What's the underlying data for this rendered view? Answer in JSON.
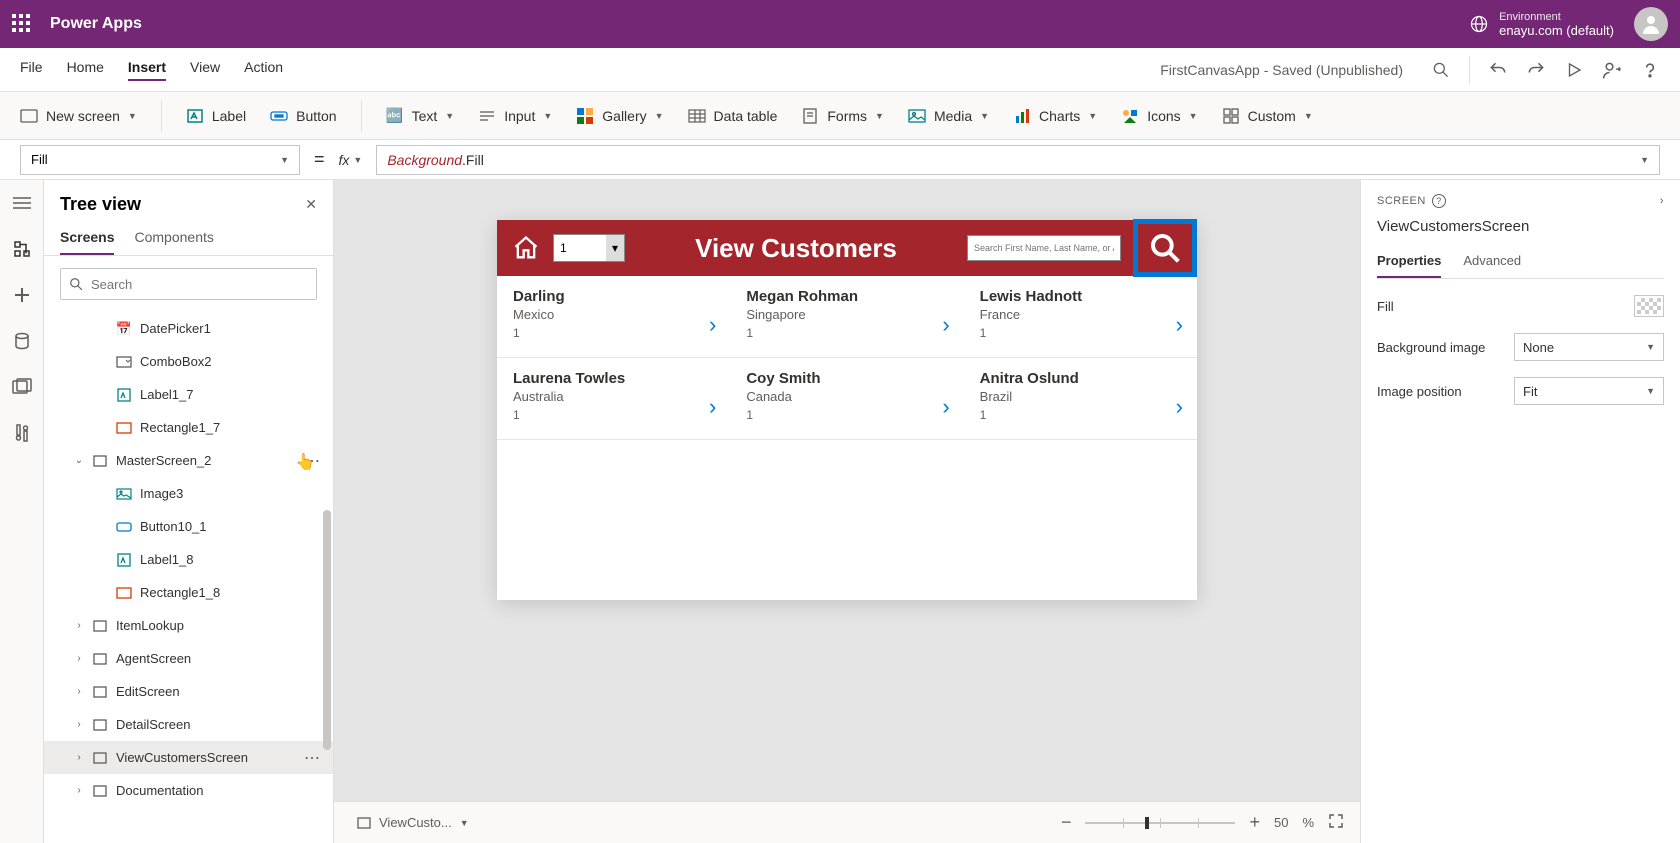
{
  "header": {
    "title": "Power Apps",
    "env_label": "Environment",
    "env_name": "enayu.com (default)"
  },
  "menubar": {
    "items": [
      "File",
      "Home",
      "Insert",
      "View",
      "Action"
    ],
    "active": "Insert",
    "app_status": "FirstCanvasApp - Saved (Unpublished)"
  },
  "ribbon": {
    "new_screen": "New screen",
    "label": "Label",
    "button": "Button",
    "text": "Text",
    "input": "Input",
    "gallery": "Gallery",
    "data_table": "Data table",
    "forms": "Forms",
    "media": "Media",
    "charts": "Charts",
    "icons": "Icons",
    "custom": "Custom"
  },
  "formula": {
    "property": "Fill",
    "token1": "Background",
    "token2": ".Fill"
  },
  "tree": {
    "title": "Tree view",
    "tabs": [
      "Screens",
      "Components"
    ],
    "search_placeholder": "Search",
    "nodes": {
      "n0": "DatePicker1",
      "n1": "ComboBox2",
      "n2": "Label1_7",
      "n3": "Rectangle1_7",
      "n4": "MasterScreen_2",
      "n5": "Image3",
      "n6": "Button10_1",
      "n7": "Label1_8",
      "n8": "Rectangle1_8",
      "n9": "ItemLookup",
      "n10": "AgentScreen",
      "n11": "EditScreen",
      "n12": "DetailScreen",
      "n13": "ViewCustomersScreen",
      "n14": "Documentation"
    }
  },
  "canvas": {
    "page_select": "1",
    "app_title": "View Customers",
    "search_placeholder": "Search First Name, Last Name, or Ag",
    "customers": [
      {
        "name": "Darling",
        "loc": "Mexico",
        "num": "1"
      },
      {
        "name": "Megan  Rohman",
        "loc": "Singapore",
        "num": "1"
      },
      {
        "name": "Lewis  Hadnott",
        "loc": "France",
        "num": "1"
      },
      {
        "name": "Laurena  Towles",
        "loc": "Australia",
        "num": "1"
      },
      {
        "name": "Coy  Smith",
        "loc": "Canada",
        "num": "1"
      },
      {
        "name": "Anitra  Oslund",
        "loc": "Brazil",
        "num": "1"
      }
    ],
    "breadcrumb": "ViewCusto...",
    "zoom_value": "50",
    "zoom_pct": "%"
  },
  "props": {
    "scope": "SCREEN",
    "name": "ViewCustomersScreen",
    "tabs": [
      "Properties",
      "Advanced"
    ],
    "fill": "Fill",
    "bg_image_label": "Background image",
    "bg_image_value": "None",
    "img_pos_label": "Image position",
    "img_pos_value": "Fit"
  }
}
